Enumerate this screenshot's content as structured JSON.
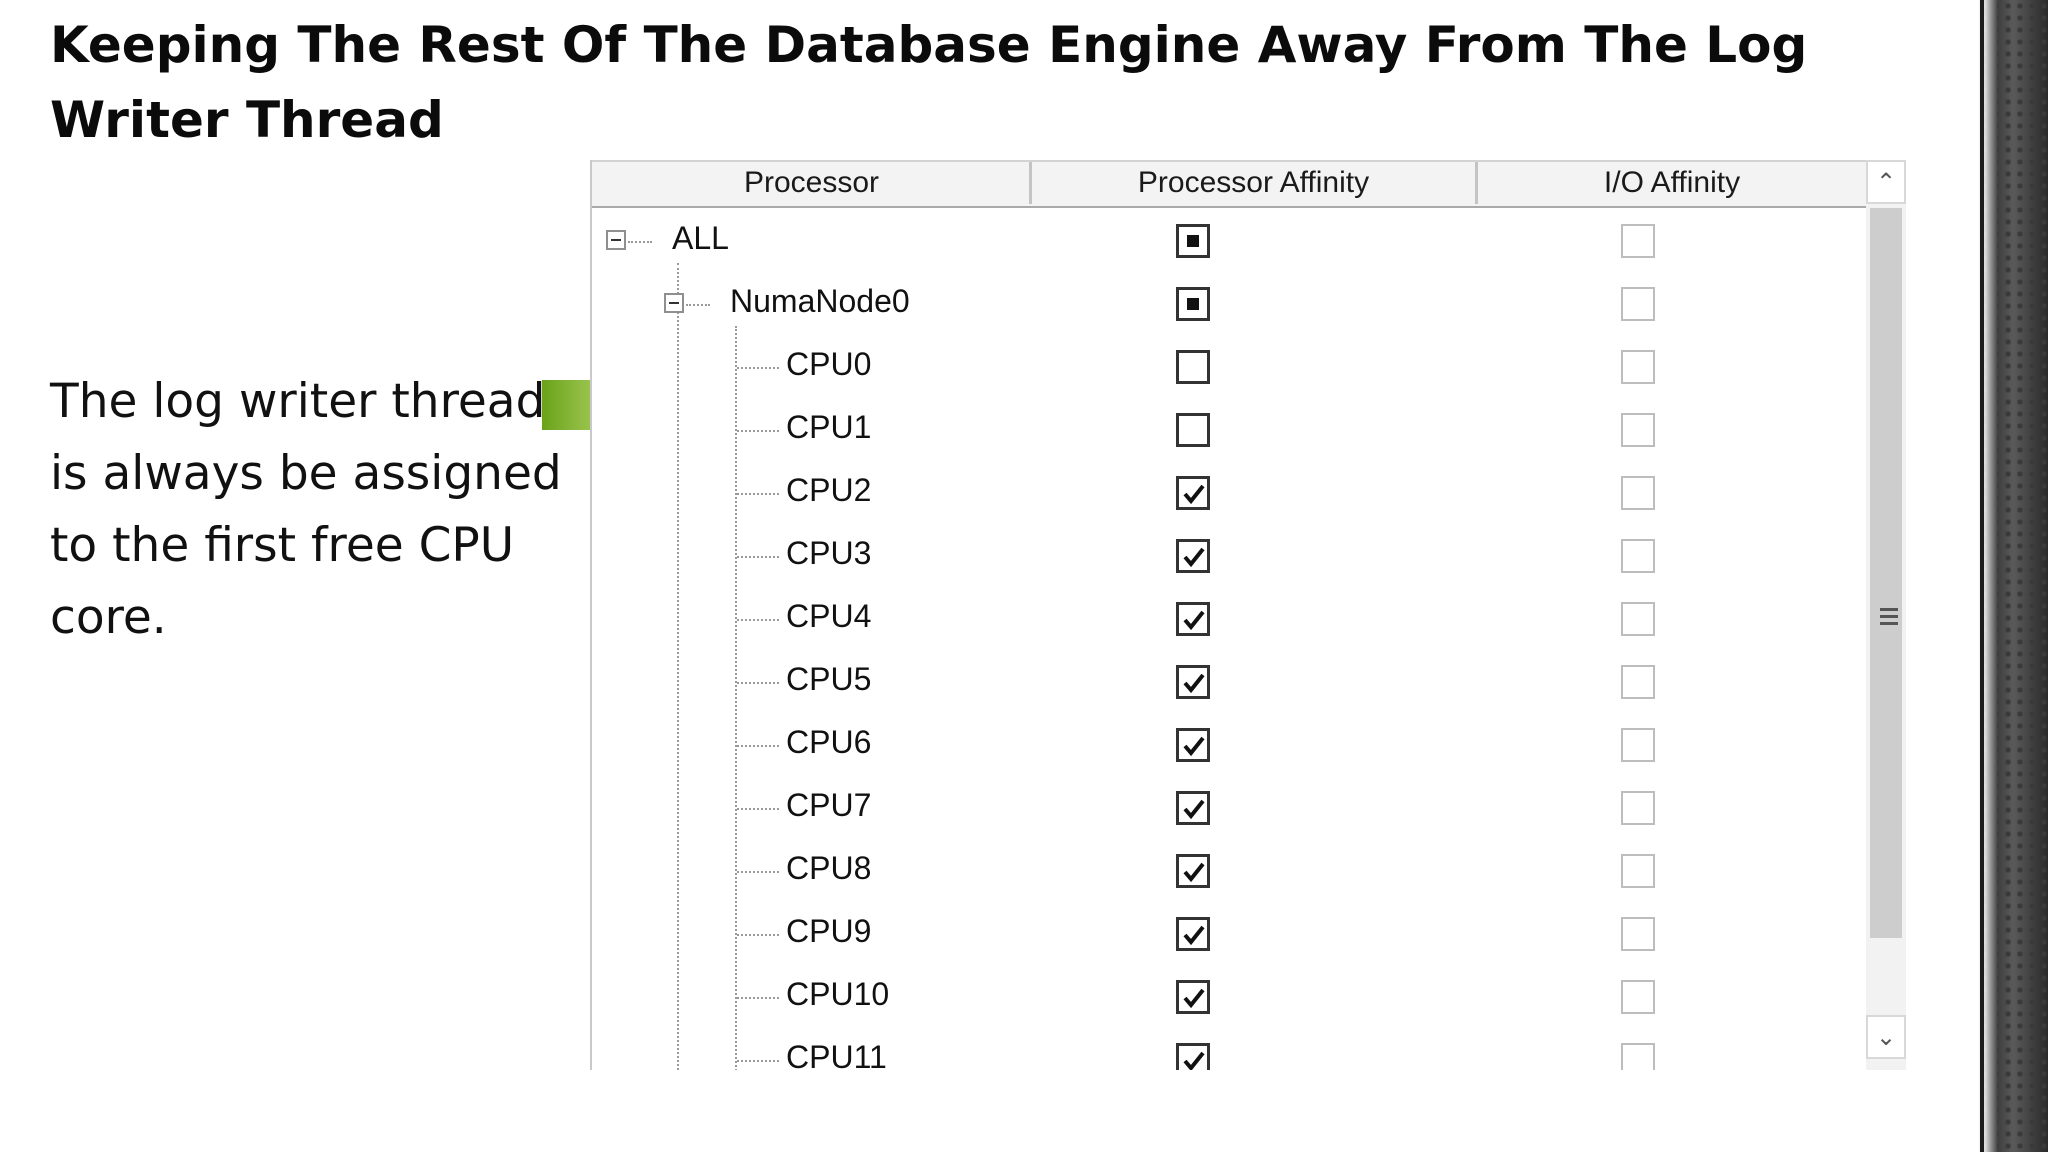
{
  "slide": {
    "title": "Keeping The Rest Of The Database Engine Away From The Log Writer Thread",
    "body": "The log writer thread is always be assigned to the first free CPU core."
  },
  "grid": {
    "columns": [
      "Processor",
      "Processor Affinity",
      "I/O Affinity"
    ],
    "rows": [
      {
        "label": "ALL",
        "level": 0,
        "expander": true,
        "processor_affinity": "partial",
        "io_affinity": "unchecked"
      },
      {
        "label": "NumaNode0",
        "level": 1,
        "expander": true,
        "processor_affinity": "partial",
        "io_affinity": "unchecked"
      },
      {
        "label": "CPU0",
        "level": 2,
        "processor_affinity": "unchecked",
        "io_affinity": "unchecked"
      },
      {
        "label": "CPU1",
        "level": 2,
        "processor_affinity": "unchecked",
        "io_affinity": "unchecked"
      },
      {
        "label": "CPU2",
        "level": 2,
        "processor_affinity": "checked",
        "io_affinity": "unchecked"
      },
      {
        "label": "CPU3",
        "level": 2,
        "processor_affinity": "checked",
        "io_affinity": "unchecked"
      },
      {
        "label": "CPU4",
        "level": 2,
        "processor_affinity": "checked",
        "io_affinity": "unchecked"
      },
      {
        "label": "CPU5",
        "level": 2,
        "processor_affinity": "checked",
        "io_affinity": "unchecked"
      },
      {
        "label": "CPU6",
        "level": 2,
        "processor_affinity": "checked",
        "io_affinity": "unchecked"
      },
      {
        "label": "CPU7",
        "level": 2,
        "processor_affinity": "checked",
        "io_affinity": "unchecked"
      },
      {
        "label": "CPU8",
        "level": 2,
        "processor_affinity": "checked",
        "io_affinity": "unchecked"
      },
      {
        "label": "CPU9",
        "level": 2,
        "processor_affinity": "checked",
        "io_affinity": "unchecked"
      },
      {
        "label": "CPU10",
        "level": 2,
        "processor_affinity": "checked",
        "io_affinity": "unchecked"
      },
      {
        "label": "CPU11",
        "level": 2,
        "processor_affinity": "checked",
        "io_affinity": "unchecked"
      }
    ]
  },
  "scrollbar": {
    "up_icon": "chevron-up-icon",
    "down_icon": "chevron-down-icon",
    "grip_icon": "grip-icon"
  },
  "colors": {
    "arrow": "#8cc63f",
    "check": "#111111"
  }
}
